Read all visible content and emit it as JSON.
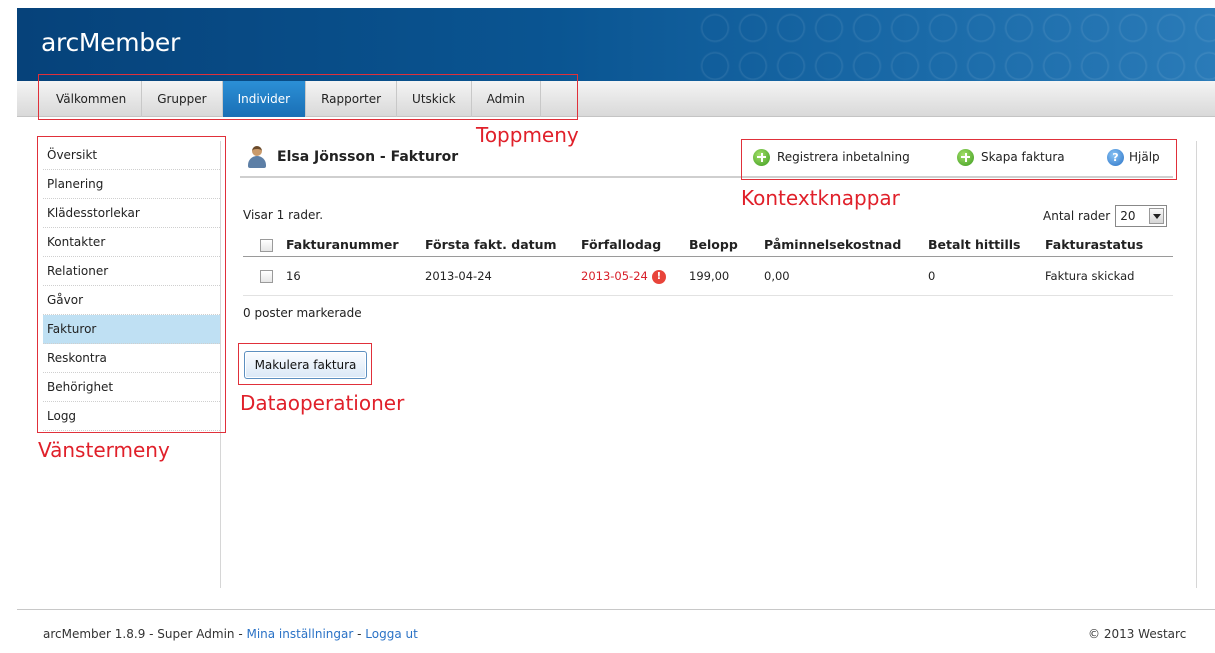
{
  "app": {
    "title": "arcMember"
  },
  "topmenu": {
    "items": [
      {
        "label": "Välkommen"
      },
      {
        "label": "Grupper"
      },
      {
        "label": "Individer"
      },
      {
        "label": "Rapporter"
      },
      {
        "label": "Utskick"
      },
      {
        "label": "Admin"
      }
    ],
    "active": "Individer"
  },
  "leftmenu": {
    "items": [
      {
        "label": "Översikt"
      },
      {
        "label": "Planering"
      },
      {
        "label": "Klädesstorlekar"
      },
      {
        "label": "Kontakter"
      },
      {
        "label": "Relationer"
      },
      {
        "label": "Gåvor"
      },
      {
        "label": "Fakturor"
      },
      {
        "label": "Reskontra"
      },
      {
        "label": "Behörighet"
      },
      {
        "label": "Logg"
      }
    ],
    "active": "Fakturor"
  },
  "page": {
    "title": "Elsa Jönsson - Fakturor"
  },
  "context_buttons": {
    "register_payment": "Registrera inbetalning",
    "create_invoice": "Skapa faktura",
    "help": "Hjälp"
  },
  "table": {
    "row_info": "Visar 1 rader.",
    "rows_per_page_label": "Antal rader",
    "rows_per_page_value": "20",
    "columns": [
      "Fakturanummer",
      "Första fakt. datum",
      "Förfallodag",
      "Belopp",
      "Påminnelsekostnad",
      "Betalt hittills",
      "Fakturastatus"
    ],
    "rows": [
      {
        "invoice_number": "16",
        "first_invoice_date": "2013-04-24",
        "due_date": "2013-05-24",
        "amount": "199,00",
        "reminder_cost": "0,00",
        "paid_so_far": "0",
        "status": "Faktura skickad"
      }
    ],
    "selected_info": "0 poster markerade"
  },
  "actions": {
    "void_invoice": "Makulera faktura"
  },
  "annotations": {
    "topmenu": "Toppmeny",
    "context": "Kontextknappar",
    "leftmenu": "Vänstermeny",
    "dataops": "Dataoperationer"
  },
  "footer": {
    "version": "arcMember 1.8.9 - Super Admin - ",
    "my_settings": "Mina inställningar",
    "separator": " - ",
    "logout": "Logga ut",
    "copyright": "© 2013 Westarc"
  },
  "colors": {
    "header_blue": "#0a5592",
    "active_tab": "#2b8fd6",
    "active_left": "#bfe0f3",
    "annotation_red": "#e0303a",
    "overdue_red": "#d8202a",
    "link_blue": "#2a72c6"
  }
}
